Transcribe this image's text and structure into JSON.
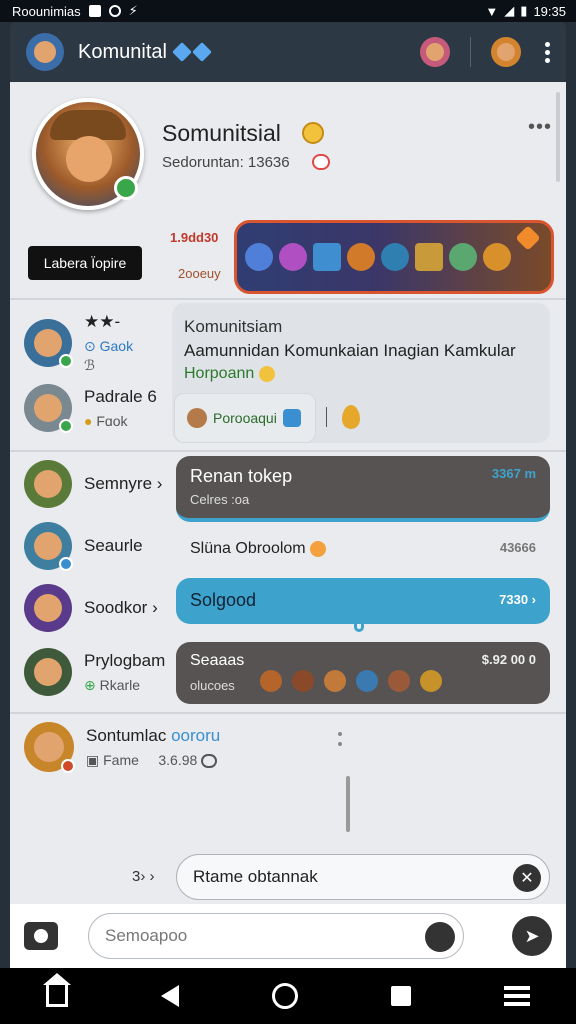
{
  "status_bar": {
    "left_text": "Roounimias",
    "time": "19:35"
  },
  "app_bar": {
    "title": "Komunital",
    "icons": [
      "avatar-icon",
      "gem-badge-icon",
      "character-icon",
      "character-icon",
      "overflow-menu-icon"
    ]
  },
  "profile": {
    "name": "Somunitsial",
    "sub_label": "Sedoruntan: 13636",
    "action_button": "Labera Ïopire",
    "stat_top": "1.9dd30",
    "stat_bottom": "2ooeuy"
  },
  "friends": [
    {
      "name": "★★-",
      "sub": "Gaok",
      "extra": "ℬ"
    },
    {
      "name": "Padrale",
      "name_suffix": "6",
      "sub": "Fɑok"
    },
    {
      "name": "Semnyre",
      "chevron": "›"
    },
    {
      "name": "Seaurle"
    },
    {
      "name": "Soodkor",
      "chevron": "›"
    },
    {
      "name": "Prylogbam",
      "sub": "Rkarle"
    },
    {
      "name": "Sontumlac",
      "name_tag": "oororu",
      "sub": "Fame",
      "value": "3.6.98"
    }
  ],
  "message_card": {
    "title": "Komunitsiam",
    "body": "Aamunnidan Komunkaian Inagian Kamkular",
    "link": "Horpoann",
    "reaction_label": "Porooaqui"
  },
  "bubbles": [
    {
      "title": "Renan tokep",
      "sub": "Celres :oa",
      "value": "3367 m"
    },
    {
      "title": "Slüna Obroolom",
      "value": "43666"
    },
    {
      "title": "Solgood",
      "value": "7330 ›"
    },
    {
      "title": "Seaaas",
      "sub": "olucoes",
      "value": "$.92 00 0"
    }
  ],
  "reply_prompt": {
    "left_text": "3› ›",
    "input_text": "Rtame obtannak"
  },
  "compose": {
    "placeholder": "Semoapoo"
  },
  "colors": {
    "app_bar": "#2c3843",
    "accent_blue": "#3ea3cc",
    "dark_bubble": "#575353",
    "strip_border": "#d9552f"
  }
}
